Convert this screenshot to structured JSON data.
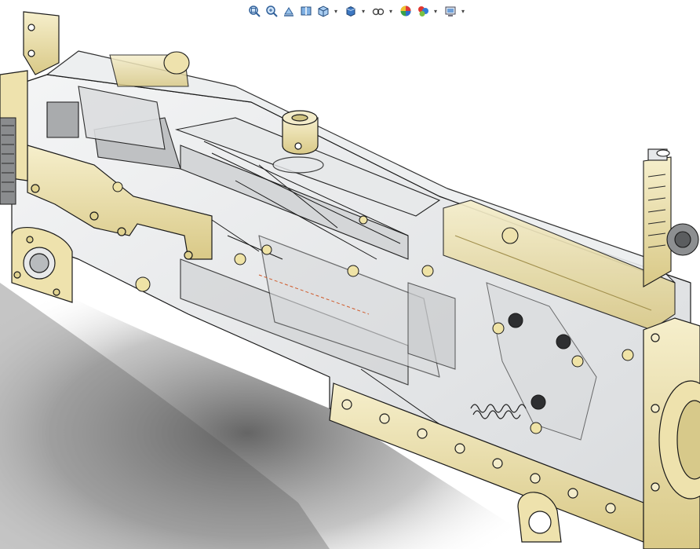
{
  "app": {
    "viewport_label": "",
    "colors": {
      "background": "#ffffff",
      "brass": "#eee2ad",
      "brass_dark": "#b8a35a",
      "steel": "#c9c9c9",
      "transparent_body": "#e4e6e8",
      "edges": "#1a1a1a",
      "shadow": "#6b6b6b"
    }
  },
  "heads_up_toolbar": {
    "buttons": [
      {
        "name": "zoom-to-fit-icon",
        "has_dropdown": false
      },
      {
        "name": "zoom-to-area-icon",
        "has_dropdown": false
      },
      {
        "name": "previous-view-icon",
        "has_dropdown": false
      },
      {
        "name": "section-view-icon",
        "has_dropdown": false
      },
      {
        "name": "view-orientation-icon",
        "has_dropdown": true
      },
      {
        "name": "display-style-icon",
        "has_dropdown": true
      },
      {
        "name": "hide-show-items-icon",
        "has_dropdown": true
      },
      {
        "name": "edit-appearance-icon",
        "has_dropdown": false
      },
      {
        "name": "apply-scene-icon",
        "has_dropdown": true
      },
      {
        "name": "view-settings-icon",
        "has_dropdown": true
      }
    ],
    "dropdown_glyph": "▾"
  }
}
